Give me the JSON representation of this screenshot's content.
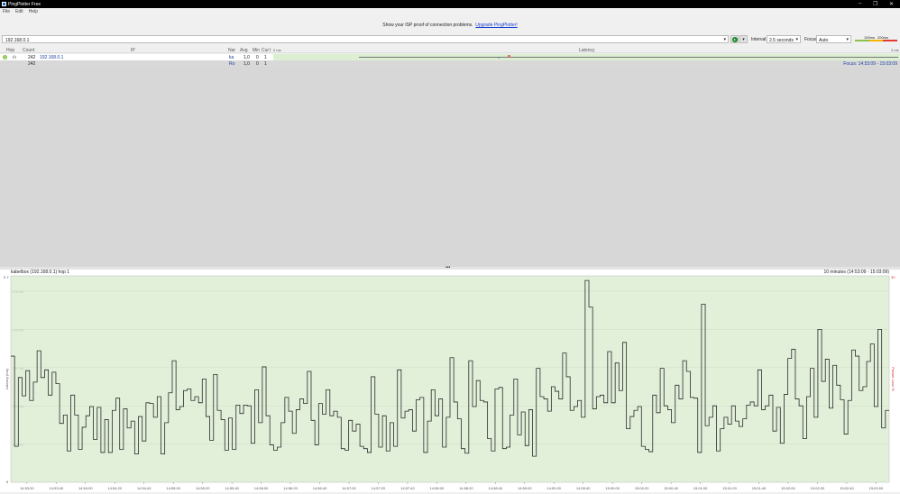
{
  "window": {
    "title": "PingPlotter Free"
  },
  "menu": [
    "File",
    "Edit",
    "Help"
  ],
  "banner": {
    "text": "Show your ISP proof of connection problems.",
    "link": "Upgrade PingPlotter!"
  },
  "toolbar": {
    "target": "192.168.0.1",
    "interval_label": "Interval",
    "interval": "2.5 seconds",
    "focus_label": "Focus",
    "focus": "Auto",
    "scale_100": "100ms",
    "scale_200": "200ms"
  },
  "table": {
    "headers": {
      "hop": "Hop",
      "count": "Count",
      "ip": "IP",
      "name": "Nar",
      "avg": "Avg",
      "min": "Min",
      "cur": "Cur",
      "pl": "I",
      "latency": "Latency",
      "lat_min": "0 ms",
      "lat_max": "3 ms"
    },
    "rows": [
      {
        "hop": "1",
        "count": "242",
        "ip": "192.168.0.1",
        "name": "ka",
        "avg": "1,0",
        "min": "0",
        "cur": "1"
      }
    ],
    "summary": {
      "count": "242",
      "name": "Ro",
      "avg": "1,0",
      "min": "0",
      "cur": "1"
    },
    "focus": "Focus: 14:53:09 - 15:03:09"
  },
  "graph": {
    "title": "kabelbox (192.168.0.1) hop 1",
    "range": "10 minutes (14:53:09 - 15:03:09)",
    "colors": {
      "bg": "#e2f0da",
      "line": "#2b2b2b",
      "loss": "#d23030"
    }
  },
  "chart_data": {
    "type": "line",
    "ylabel": "Latency (ms)",
    "y2label": "Packet Loss %",
    "ylim": [
      0,
      2.7
    ],
    "y2max": "30",
    "ytop": "2.7",
    "ybottom": "0",
    "yticks": [
      "2,5 ms",
      "2,0 ms",
      "1,5 ms",
      "1,0 ms",
      "0,5 ms"
    ],
    "ytick_values": [
      2.5,
      2.0,
      1.5,
      1.0,
      0.5
    ],
    "x_start": "14:53:09",
    "x_end": "15:03:09",
    "xticks": [
      "14:53:20",
      "14:53:40",
      "14:54:00",
      "14:54:20",
      "14:54:40",
      "14:55:00",
      "14:55:20",
      "14:55:40",
      "14:56:00",
      "14:56:20",
      "14:56:40",
      "14:57:00",
      "14:57:20",
      "14:57:40",
      "14:58:00",
      "14:58:20",
      "14:58:40",
      "14:59:00",
      "14:59:20",
      "14:59:40",
      "15:00:00",
      "15:00:20",
      "15:00:40",
      "15:01:00",
      "15:01:20",
      "15:01:40",
      "15:02:00",
      "15:02:20",
      "15:02:40",
      "15:03:00"
    ],
    "step": "step",
    "values": [
      1.65,
      0.47,
      1.37,
      1.13,
      1.46,
      1.07,
      1.31,
      1.72,
      1.37,
      1.47,
      1.14,
      1.44,
      1.29,
      0.77,
      0.88,
      0.41,
      1.14,
      0.88,
      0.43,
      0.72,
      0.87,
      0.99,
      0.56,
      0.98,
      0.39,
      0.82,
      0.39,
      0.94,
      1.1,
      0.43,
      0.96,
      0.71,
      0.8,
      0.37,
      0.86,
      0.54,
      1.04,
      1.03,
      0.85,
      1.12,
      0.37,
      0.78,
      1.17,
      1.59,
      0.95,
      0.99,
      1.2,
      1.22,
      1.07,
      1.12,
      1.04,
      1.35,
      0.86,
      0.55,
      1.41,
      0.94,
      0.82,
      0.42,
      0.84,
      0.43,
      1.01,
      0.9,
      1.01,
      1.0,
      0.51,
      1.21,
      0.78,
      1.51,
      0.87,
      0.49,
      0.42,
      0.46,
      0.78,
      1.11,
      0.93,
      0.64,
      0.95,
      1.09,
      1.03,
      1.45,
      0.81,
      0.49,
      1.03,
      0.89,
      1.21,
      0.87,
      0.93,
      0.85,
      0.44,
      0.42,
      0.81,
      0.67,
      0.76,
      0.47,
      0.44,
      0.39,
      1.38,
      0.89,
      0.46,
      0.87,
      0.41,
      0.78,
      0.47,
      1.47,
      0.84,
      0.93,
      0.95,
      0.67,
      1.08,
      1.11,
      0.39,
      0.8,
      1.21,
      0.87,
      1.09,
      0.46,
      0.85,
      1.63,
      1.05,
      0.83,
      0.44,
      0.38,
      1.59,
      0.99,
      1.33,
      1.07,
      1.05,
      0.57,
      0.41,
      1.22,
      1.24,
      0.44,
      0.46,
      0.88,
      1.35,
      0.62,
      0.92,
      0.48,
      0.95,
      0.34,
      1.49,
      1.12,
      1.09,
      0.93,
      1.25,
      1.19,
      1.09,
      1.69,
      1.38,
      0.94,
      0.99,
      1.07,
      0.85,
      2.64,
      2.29,
      0.96,
      1.12,
      1.14,
      1.04,
      1.71,
      1.04,
      1.56,
      1.2,
      1.83,
      0.7,
      0.86,
      0.94,
      0.99,
      0.47,
      0.43,
      0.4,
      1.14,
      0.91,
      1.49,
      1.0,
      0.95,
      0.78,
      1.27,
      1.09,
      1.59,
      1.45,
      1.11,
      1.1,
      0.39,
      2.33,
      0.74,
      0.85,
      1.0,
      0.41,
      0.7,
      0.85,
      0.76,
      1.0,
      0.8,
      0.73,
      0.83,
      1.01,
      1.05,
      1.0,
      1.47,
      0.95,
      1.0,
      1.14,
      0.67,
      0.98,
      0.51,
      1.15,
      1.62,
      1.74,
      1.09,
      1.0,
      0.57,
      1.12,
      1.49,
      0.85,
      2.0,
      1.32,
      1.61,
      0.97,
      1.53,
      1.27,
      1.08,
      0.63,
      1.07,
      1.73,
      1.65,
      1.2,
      1.25,
      1.58,
      1.81,
      0.99,
      2.0,
      0.71,
      0.94
    ]
  }
}
